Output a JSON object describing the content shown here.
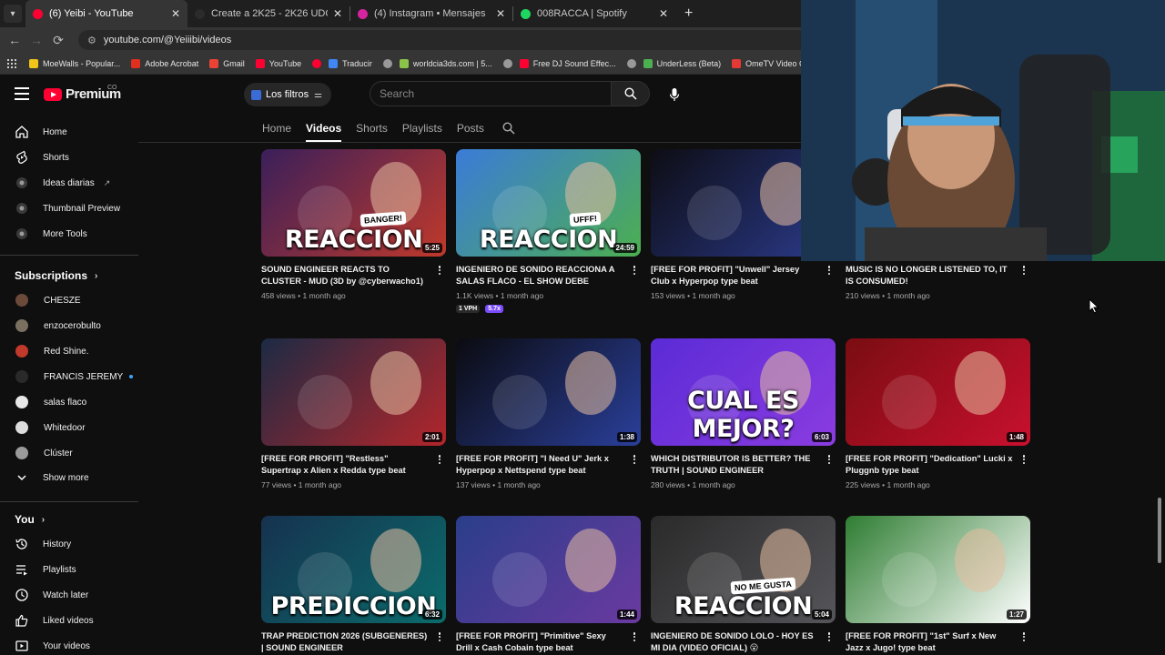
{
  "browser": {
    "tabs": [
      {
        "label": "(6) Yeibi - YouTube",
        "active": true,
        "favicon_color": "#ff0033"
      },
      {
        "label": "Create a 2K25 - 2K26 UDG CYP",
        "active": false,
        "favicon_color": "#2b2b2b"
      },
      {
        "label": "(4) Instagram • Mensajes",
        "active": false,
        "favicon_color": "#d6249f"
      },
      {
        "label": "008RACCA | Spotify",
        "active": false,
        "favicon_color": "#1ed760"
      }
    ],
    "url": "youtube.com/@Yeiiibi/videos",
    "bookmarks": [
      {
        "label": "MoeWalls - Popular...",
        "color": "#f0c419"
      },
      {
        "label": "Adobe Acrobat",
        "color": "#e02f1f"
      },
      {
        "label": "Gmail",
        "color": "#ea4335"
      },
      {
        "label": "YouTube",
        "color": "#ff0033"
      },
      {
        "label": "",
        "color": "#ff0033"
      },
      {
        "label": "Traducir",
        "color": "#4285f4"
      },
      {
        "label": "",
        "color": "#999999"
      },
      {
        "label": "worldcia3ds.com | 5...",
        "color": "#8bc34a"
      },
      {
        "label": "",
        "color": "#999999"
      },
      {
        "label": "Free DJ Sound Effec...",
        "color": "#ff0033"
      },
      {
        "label": "",
        "color": "#999999"
      },
      {
        "label": "UnderLess (Beta)",
        "color": "#4caf50"
      },
      {
        "label": "OmeTV Video Chat...",
        "color": "#e53935"
      }
    ]
  },
  "masthead": {
    "logo_text": "Premium",
    "logo_superscript": "CO",
    "filters_chip": "Los filtros",
    "search_placeholder": "Search"
  },
  "sidebar": {
    "main": [
      {
        "label": "Home",
        "icon": "home-icon"
      },
      {
        "label": "Shorts",
        "icon": "shorts-icon"
      },
      {
        "label": "Ideas diarias",
        "icon": "circle-app-icon",
        "external": true
      },
      {
        "label": "Thumbnail Preview",
        "icon": "circle-app-icon"
      },
      {
        "label": "More Tools",
        "icon": "circle-app-icon"
      }
    ],
    "subscriptions_title": "Subscriptions",
    "subscriptions": [
      {
        "label": "CHESZE",
        "color": "#6b4a3a"
      },
      {
        "label": "enzocerobulto",
        "color": "#7a7060"
      },
      {
        "label": "Red Shine.",
        "color": "#c0392b"
      },
      {
        "label": "FRANCIS JEREMY",
        "color": "#2a2a2a",
        "live": true
      },
      {
        "label": "salas flaco",
        "color": "#e8e8e8"
      },
      {
        "label": "Whitedoor",
        "color": "#dcdcdc"
      },
      {
        "label": "Clúster",
        "color": "#9a9a9a"
      }
    ],
    "show_more": "Show more",
    "you_title": "You",
    "you": [
      {
        "label": "History",
        "icon": "history-icon"
      },
      {
        "label": "Playlists",
        "icon": "playlists-icon"
      },
      {
        "label": "Watch later",
        "icon": "watch-later-icon"
      },
      {
        "label": "Liked videos",
        "icon": "like-icon"
      },
      {
        "label": "Your videos",
        "icon": "your-videos-icon"
      }
    ]
  },
  "channel_tabs": [
    {
      "label": "Home",
      "active": false
    },
    {
      "label": "Videos",
      "active": true
    },
    {
      "label": "Shorts",
      "active": false
    },
    {
      "label": "Playlists",
      "active": false
    },
    {
      "label": "Posts",
      "active": false
    }
  ],
  "videos": [
    {
      "title": "SOUND ENGINEER REACTS TO CLUSTER - MUD (3D by @cyberwacho1) 🔥",
      "views": "458 views",
      "age": "1 month ago",
      "duration": "5:25",
      "thumb_text": "REACCION",
      "sticker": "BANGER!",
      "bg": [
        "#3a1f5a",
        "#c0392b"
      ]
    },
    {
      "title": "INGENIERO DE SONIDO REACCIONA A SALAS FLACO - EL SHOW DEBE CONTINU...",
      "views": "1.1K views",
      "age": "1 month ago",
      "duration": "24:59",
      "thumb_text": "REACCION",
      "sticker": "UFFF!",
      "bg": [
        "#3b7bd8",
        "#4caf50"
      ],
      "badges": [
        {
          "text": "1 VPH",
          "bg": "#2a2a2a",
          "color": "#ffffff"
        },
        {
          "text": "5.7x",
          "bg": "#7b4dff",
          "color": "#ffffff"
        }
      ]
    },
    {
      "title": "[FREE FOR PROFIT] \"Unwell\" Jersey Club x Hyperpop type beat",
      "views": "153 views",
      "age": "1 month ago",
      "duration": "",
      "thumb_text": "",
      "sticker": "",
      "bg": [
        "#0d0d14",
        "#2b3a8a"
      ]
    },
    {
      "title": "MUSIC IS NO LONGER LISTENED TO, IT IS CONSUMED!",
      "views": "210 views",
      "age": "1 month ago",
      "duration": "",
      "thumb_text": "",
      "sticker": "",
      "bg": [
        "#111111",
        "#111111"
      ]
    },
    {
      "title": "[FREE FOR PROFIT] \"Restless\" Supertrap x Alien x Redda type beat",
      "views": "77 views",
      "age": "1 month ago",
      "duration": "2:01",
      "thumb_text": "",
      "sticker": "",
      "bg": [
        "#1c2a44",
        "#b3262b"
      ]
    },
    {
      "title": "[FREE FOR PROFIT] \"I Need U\" Jerk x Hyperpop x Nettspend type beat",
      "views": "137 views",
      "age": "1 month ago",
      "duration": "1:38",
      "thumb_text": "",
      "sticker": "",
      "bg": [
        "#0b0b10",
        "#2a3f9a"
      ]
    },
    {
      "title": "WHICH DISTRIBUTOR IS BETTER? THE TRUTH | SOUND ENGINEER",
      "views": "280 views",
      "age": "1 month ago",
      "duration": "6:03",
      "thumb_text": "CUAL ES MEJOR?",
      "sticker": "",
      "bg": [
        "#5b2bd6",
        "#8a3ce0"
      ]
    },
    {
      "title": "[FREE FOR PROFIT] \"Dedication\" Lucki x Pluggnb type beat",
      "views": "225 views",
      "age": "1 month ago",
      "duration": "1:48",
      "thumb_text": "",
      "sticker": "",
      "bg": [
        "#7a0d12",
        "#c8102e"
      ]
    },
    {
      "title": "TRAP PREDICTION 2026 (SUBGENERES) | SOUND ENGINEER",
      "views": "",
      "age": "",
      "duration": "6:32",
      "thumb_text": "PREDICCION",
      "sticker": "",
      "bg": [
        "#16324f",
        "#0b6b6b"
      ]
    },
    {
      "title": "[FREE FOR PROFIT] \"Primitive\" Sexy Drill x Cash Cobain type beat",
      "views": "",
      "age": "",
      "duration": "1:44",
      "thumb_text": "",
      "sticker": "",
      "bg": [
        "#2a3e8a",
        "#6a3aa0"
      ]
    },
    {
      "title": "INGENIERO DE SONIDO LOLO - HOY ES MI DIA (VIDEO OFICIAL) 😮",
      "views": "",
      "age": "",
      "duration": "5:04",
      "thumb_text": "REACCION",
      "sticker": "NO ME GUSTA",
      "bg": [
        "#2a2a2a",
        "#55555a"
      ]
    },
    {
      "title": "[FREE FOR PROFIT] \"1st\" Surf x New Jazz x Jugo! type beat",
      "views": "",
      "age": "",
      "duration": "1:27",
      "thumb_text": "",
      "sticker": "",
      "bg": [
        "#2e7d32",
        "#ffffff"
      ]
    }
  ]
}
